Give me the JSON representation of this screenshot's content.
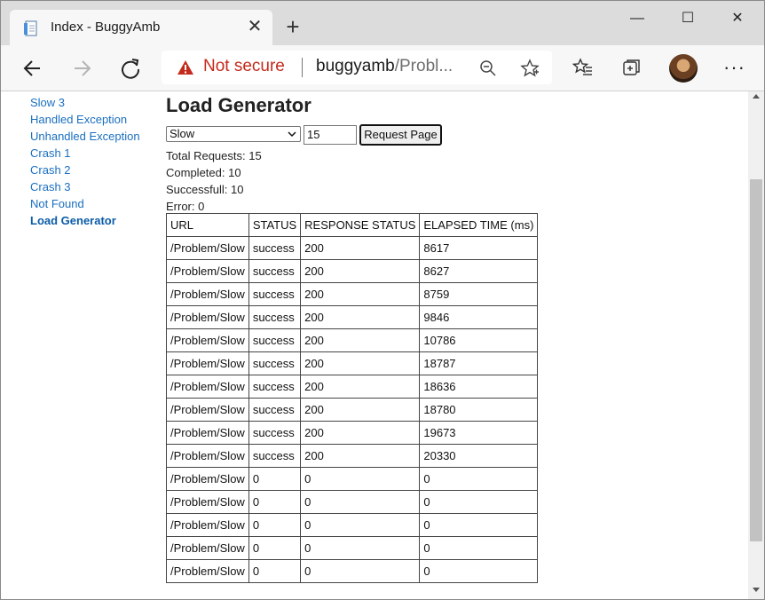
{
  "tab": {
    "title": "Index - BuggyAmb",
    "close_glyph": "✕",
    "new_tab_glyph": "+"
  },
  "window_controls": {
    "minimize": "—",
    "maximize": "☐",
    "close": "✕"
  },
  "address_bar": {
    "security_text": "Not secure",
    "host": "buggyamb",
    "path": "/Probl..."
  },
  "toolbar": {
    "more_glyph": "···"
  },
  "sidenav": {
    "items": [
      {
        "label": "Slow 3",
        "active": false
      },
      {
        "label": "Handled Exception",
        "active": false
      },
      {
        "label": "Unhandled Exception",
        "active": false
      },
      {
        "label": "Crash 1",
        "active": false
      },
      {
        "label": "Crash 2",
        "active": false
      },
      {
        "label": "Crash 3",
        "active": false
      },
      {
        "label": "Not Found",
        "active": false
      },
      {
        "label": "Load Generator",
        "active": true
      }
    ]
  },
  "main": {
    "heading": "Load Generator",
    "select_value": "Slow",
    "count_value": "15",
    "request_button": "Request Page",
    "stats": {
      "total": "Total Requests: 15",
      "completed": "Completed: 10",
      "successful": "Successfull: 10",
      "error": "Error: 0"
    },
    "table": {
      "headers": [
        "URL",
        "STATUS",
        "RESPONSE STATUS",
        "ELAPSED TIME (ms)"
      ],
      "rows": [
        [
          "/Problem/Slow",
          "success",
          "200",
          "8617"
        ],
        [
          "/Problem/Slow",
          "success",
          "200",
          "8627"
        ],
        [
          "/Problem/Slow",
          "success",
          "200",
          "8759"
        ],
        [
          "/Problem/Slow",
          "success",
          "200",
          "9846"
        ],
        [
          "/Problem/Slow",
          "success",
          "200",
          "10786"
        ],
        [
          "/Problem/Slow",
          "success",
          "200",
          "18787"
        ],
        [
          "/Problem/Slow",
          "success",
          "200",
          "18636"
        ],
        [
          "/Problem/Slow",
          "success",
          "200",
          "18780"
        ],
        [
          "/Problem/Slow",
          "success",
          "200",
          "19673"
        ],
        [
          "/Problem/Slow",
          "success",
          "200",
          "20330"
        ],
        [
          "/Problem/Slow",
          "0",
          "0",
          "0"
        ],
        [
          "/Problem/Slow",
          "0",
          "0",
          "0"
        ],
        [
          "/Problem/Slow",
          "0",
          "0",
          "0"
        ],
        [
          "/Problem/Slow",
          "0",
          "0",
          "0"
        ],
        [
          "/Problem/Slow",
          "0",
          "0",
          "0"
        ]
      ]
    }
  },
  "colors": {
    "link": "#1a6fbf",
    "not_secure": "#c42b1c",
    "tabbar": "#dcdcdc"
  }
}
